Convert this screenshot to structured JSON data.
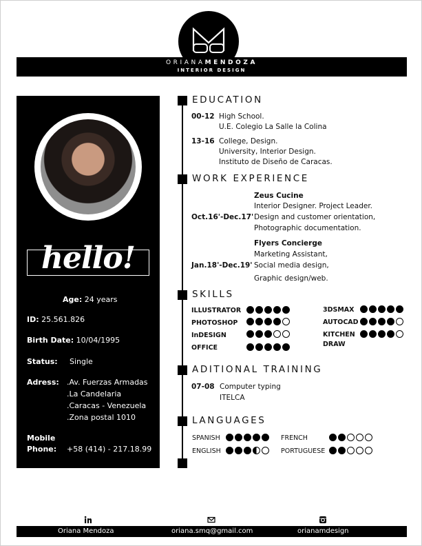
{
  "header": {
    "name_first": "ORIANA",
    "name_last": "MENDOZA",
    "title": "INTERIOR DESIGN"
  },
  "profile": {
    "hello": "hello!",
    "age_label": "Age:",
    "age_value": "24 years",
    "id_label": "ID:",
    "id_value": "25.561.826",
    "birth_label": "Birth Date:",
    "birth_value": "10/04/1995",
    "status_label": "Status:",
    "status_value": "Single",
    "address_label": "Adress:",
    "address_lines": [
      ".Av. Fuerzas Armadas",
      ".La Candelaria",
      ".Caracas - Venezuela",
      ".Zona postal 1010"
    ],
    "mobile_label_1": "Mobile",
    "mobile_label_2": "Phone:",
    "mobile_value": "+58 (414) - 217.18.99"
  },
  "education": {
    "title": "EDUCATION",
    "items": [
      {
        "years": "00-12",
        "lines": [
          "High School.",
          "U.E. Colegio La Salle la Colina"
        ]
      },
      {
        "years": "13-16",
        "lines": [
          "College, Design.",
          "University, Interior Design.",
          "Instituto de Diseño de Caracas."
        ]
      }
    ]
  },
  "work": {
    "title": "WORK EXPERIENCE",
    "items": [
      {
        "dates": "Oct.16'-Dec.17'",
        "company": "Zeus Cucine",
        "lines": [
          "Interior Designer. Project Leader.",
          "Design and customer orientation,",
          "Photographic documentation."
        ]
      },
      {
        "dates": "Jan.18'-Dec.19'",
        "company": "Flyers Concierge",
        "lines": [
          "Marketing Assistant,",
          "Social media design,",
          "Graphic design/web."
        ]
      }
    ]
  },
  "skills": {
    "title": "SKILLS",
    "items": [
      {
        "name": "ILLUSTRATOR",
        "level": 5
      },
      {
        "name": "PHOTOSHOP",
        "level": 4
      },
      {
        "name": "InDESIGN",
        "level": 3
      },
      {
        "name": "OFFICE",
        "level": 5
      },
      {
        "name": "3DSMAX",
        "level": 5
      },
      {
        "name": "AUTOCAD",
        "level": 4
      },
      {
        "name": "KITCHEN",
        "name2": "DRAW",
        "level": 4
      }
    ]
  },
  "training": {
    "title": "ADITIONAL TRAINING",
    "years": "07-08",
    "lines": [
      "Computer typing",
      "ITELCA"
    ]
  },
  "languages": {
    "title": "LANGUAGES",
    "items": [
      {
        "name": "SPANISH",
        "level": 5
      },
      {
        "name": "ENGLISH",
        "level": 3.5
      },
      {
        "name": "FRENCH",
        "level": 2
      },
      {
        "name": "PORTUGUESE",
        "level": 2
      }
    ]
  },
  "footer": {
    "linkedin_icon": "linkedin-icon",
    "mail_icon": "mail-icon",
    "instagram_icon": "instagram-icon",
    "linkedin": "Oriana Mendoza",
    "email": "oriana.smq@gmail.com",
    "instagram": "orianamdesign"
  }
}
